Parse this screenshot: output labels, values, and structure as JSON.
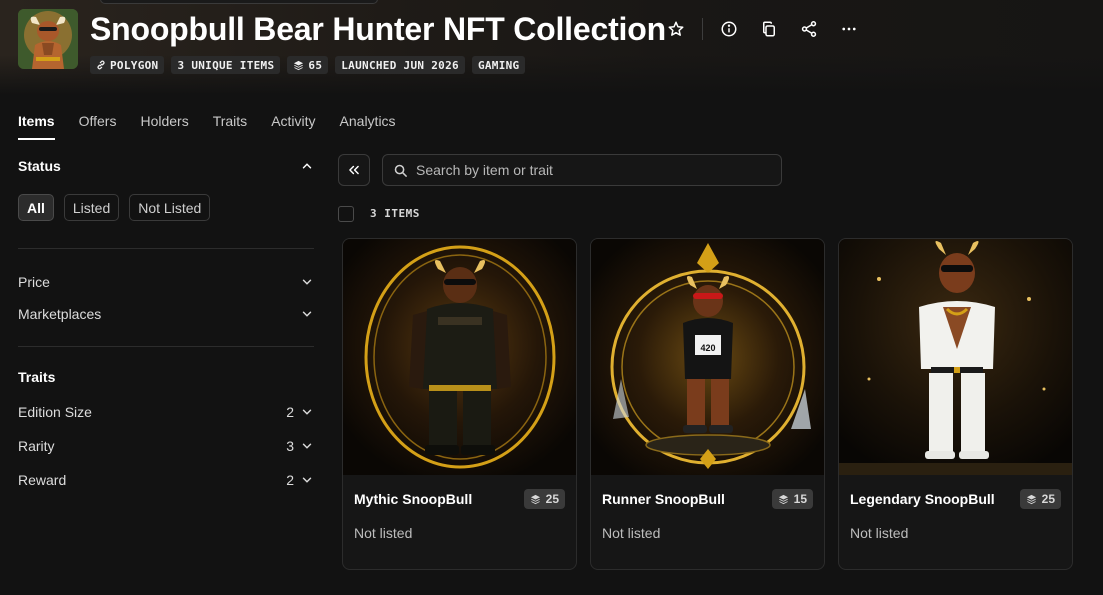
{
  "collection": {
    "title": "Snoopbull Bear Hunter NFT Collection",
    "badges": [
      {
        "icon": "link-icon",
        "label": "POLYGON"
      },
      {
        "icon": "",
        "label": "3 UNIQUE ITEMS"
      },
      {
        "icon": "layers-icon",
        "label": "65"
      },
      {
        "icon": "",
        "label": "LAUNCHED JUN 2026"
      },
      {
        "icon": "",
        "label": "GAMING"
      }
    ]
  },
  "header_actions": [
    "star-icon",
    "info-icon",
    "copy-icon",
    "share-icon",
    "more-icon"
  ],
  "tabs": [
    "Items",
    "Offers",
    "Holders",
    "Traits",
    "Activity",
    "Analytics"
  ],
  "active_tab": "Items",
  "sidebar": {
    "status_heading": "Status",
    "status_options": [
      "All",
      "Listed",
      "Not Listed"
    ],
    "status_selected": "All",
    "price_label": "Price",
    "marketplaces_label": "Marketplaces",
    "traits_heading": "Traits",
    "traits": [
      {
        "label": "Edition Size",
        "count": "2"
      },
      {
        "label": "Rarity",
        "count": "3"
      },
      {
        "label": "Reward",
        "count": "2"
      }
    ]
  },
  "search": {
    "placeholder": "Search by item or trait"
  },
  "items_count": "3 ITEMS",
  "items": [
    {
      "name": "Mythic SnoopBull",
      "edition": "25",
      "status": "Not listed"
    },
    {
      "name": "Runner SnoopBull",
      "edition": "15",
      "status": "Not listed"
    },
    {
      "name": "Legendary SnoopBull",
      "edition": "25",
      "status": "Not listed"
    }
  ],
  "colors": {
    "background": "#121212",
    "accent_gold": "#d4a017",
    "card_border": "#2c2c2c"
  }
}
